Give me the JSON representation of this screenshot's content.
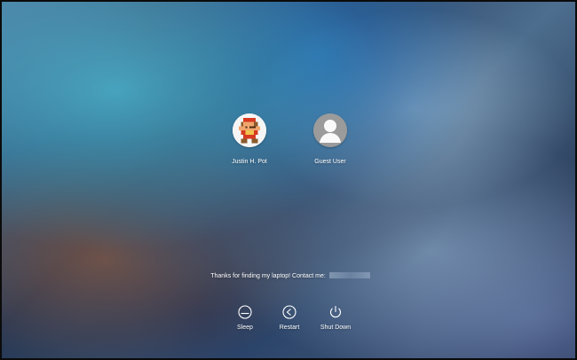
{
  "users": [
    {
      "name": "Justin H. Pot",
      "avatar_icon": "mario-avatar-icon"
    },
    {
      "name": "Guest User",
      "avatar_icon": "guest-user-icon"
    }
  ],
  "message": {
    "text": "Thanks for finding my laptop! Contact me:"
  },
  "actions": [
    {
      "label": "Sleep",
      "icon": "sleep-icon"
    },
    {
      "label": "Restart",
      "icon": "restart-icon"
    },
    {
      "label": "Shut Down",
      "icon": "power-icon"
    }
  ],
  "colors": {
    "text": "#ffffff",
    "guest_avatar": "#9b9b9b"
  }
}
